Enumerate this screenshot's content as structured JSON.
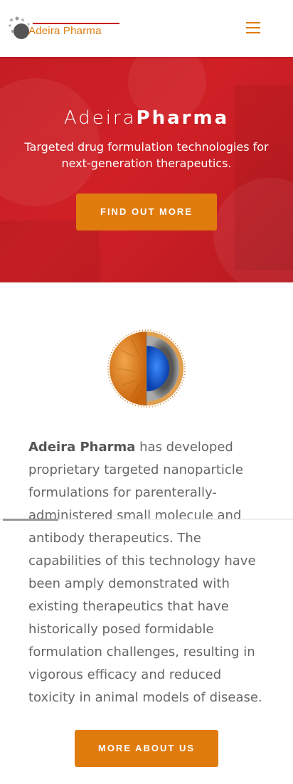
{
  "header": {
    "logo_text": "Adeira Pharma",
    "menu_icon": "hamburger-menu-icon"
  },
  "hero": {
    "title_light": "Adeira",
    "title_bold": "Pharma",
    "subtitle": "Targeted drug formulation technologies for next-generation therapeutics.",
    "button_label": "FIND OUT MORE"
  },
  "about": {
    "image_icon": "nanoparticle-illustration",
    "company_name": "Adeira Pharma",
    "paragraph": " has developed proprietary targeted nanoparticle formulations for parenterally-administered small molecule and antibody therapeutics. The capabilities of this technology have been amply demonstrated with existing therapeutics that have historically posed formidable formulation challenges, resulting in vigorous efficacy and reduced toxicity in animal models of disease.",
    "button_label": "MORE ABOUT US"
  },
  "colors": {
    "brand_orange": "#e07b0e",
    "brand_red": "#c51d24",
    "text_gray": "#666666"
  }
}
